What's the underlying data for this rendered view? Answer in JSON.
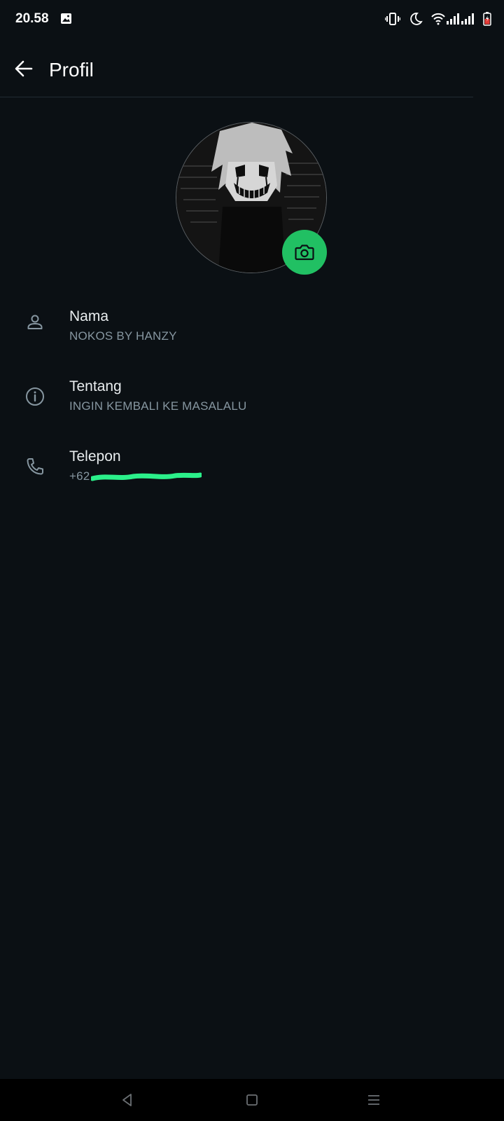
{
  "status_bar": {
    "time": "20.58",
    "icons": [
      "gallery-notification-icon",
      "vibrate-icon",
      "do-not-disturb-moon-icon",
      "wifi-icon",
      "signal-icon",
      "signal-icon",
      "battery-icon"
    ]
  },
  "app_bar": {
    "title": "Profil",
    "back_icon": "arrow-left-icon"
  },
  "avatar": {
    "camera_icon": "camera-icon",
    "accent_color": "#21c063"
  },
  "rows": [
    {
      "icon": "person-icon",
      "label": "Nama",
      "value": "NOKOS BY HANZY"
    },
    {
      "icon": "info-icon",
      "label": "Tentang",
      "value": "INGIN KEMBALI KE MASALALU"
    },
    {
      "icon": "phone-icon",
      "label": "Telepon",
      "value": "+62",
      "redacted": true
    }
  ],
  "nav_bar": {
    "icons": [
      "back-triangle-icon",
      "home-square-icon",
      "menu-lines-icon"
    ]
  },
  "colors": {
    "background": "#0b1014",
    "primary_text": "#e9edef",
    "secondary_text": "#8696a0",
    "accent": "#21c063",
    "redaction_marker": "#2bf08a"
  }
}
